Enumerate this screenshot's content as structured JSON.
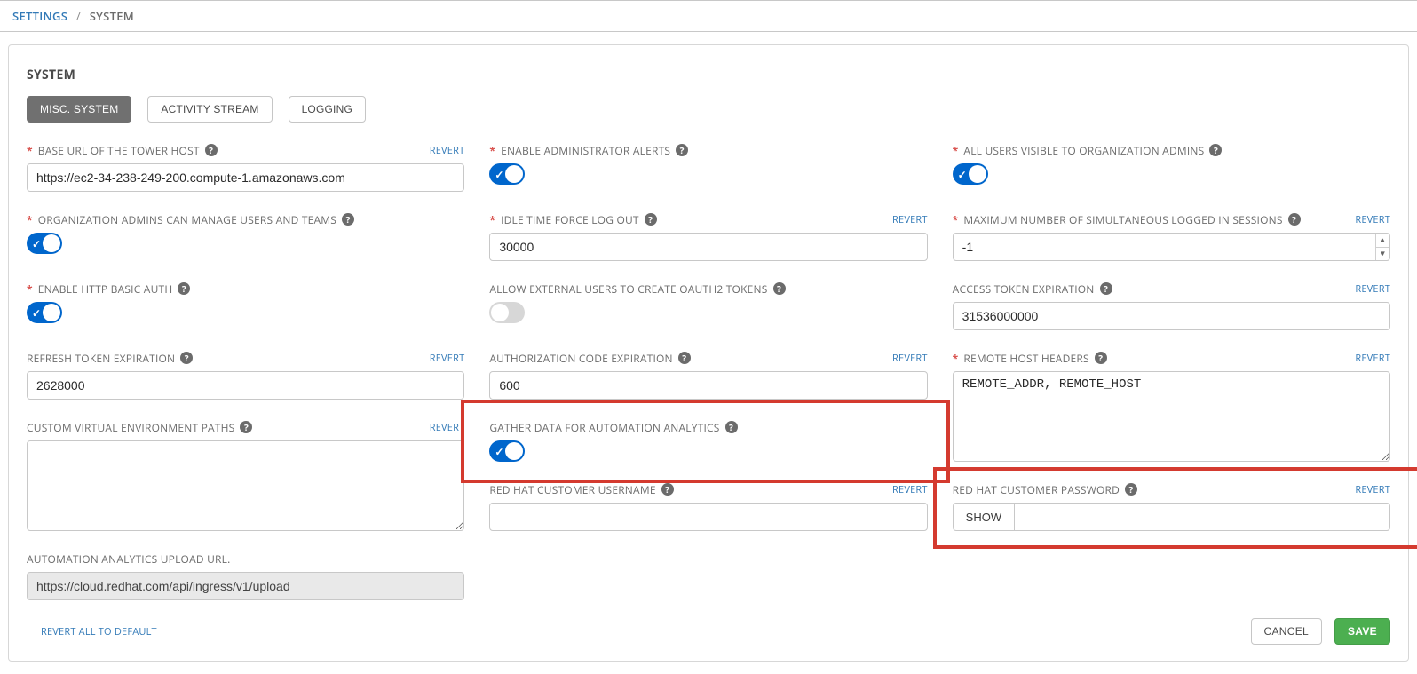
{
  "breadcrumb": {
    "root": "SETTINGS",
    "sep": "/",
    "current": "SYSTEM"
  },
  "panel": {
    "title": "SYSTEM"
  },
  "tabs": {
    "misc": "MISC. SYSTEM",
    "activity": "ACTIVITY STREAM",
    "logging": "LOGGING"
  },
  "labels": {
    "revert": "REVERT",
    "revert_all": "REVERT ALL TO DEFAULT",
    "cancel": "CANCEL",
    "save": "SAVE",
    "show": "SHOW"
  },
  "fields": {
    "base_url": {
      "label": "BASE URL OF THE TOWER HOST",
      "value": "https://ec2-34-238-249-200.compute-1.amazonaws.com",
      "required": true,
      "revert": true
    },
    "admin_alerts": {
      "label": "ENABLE ADMINISTRATOR ALERTS",
      "required": true,
      "on": true
    },
    "all_users_visible": {
      "label": "ALL USERS VISIBLE TO ORGANIZATION ADMINS",
      "required": true,
      "on": true
    },
    "org_admins_manage": {
      "label": "ORGANIZATION ADMINS CAN MANAGE USERS AND TEAMS",
      "required": true,
      "on": true
    },
    "idle_logout": {
      "label": "IDLE TIME FORCE LOG OUT",
      "required": true,
      "value": "30000",
      "revert": true
    },
    "max_sessions": {
      "label": "MAXIMUM NUMBER OF SIMULTANEOUS LOGGED IN SESSIONS",
      "required": true,
      "value": "-1",
      "revert": true
    },
    "http_basic": {
      "label": "ENABLE HTTP BASIC AUTH",
      "required": true,
      "on": true
    },
    "oauth_external": {
      "label": "ALLOW EXTERNAL USERS TO CREATE OAUTH2 TOKENS",
      "on": false
    },
    "access_token_exp": {
      "label": "ACCESS TOKEN EXPIRATION",
      "value": "31536000000",
      "revert": true
    },
    "refresh_token_exp": {
      "label": "REFRESH TOKEN EXPIRATION",
      "value": "2628000",
      "revert": true
    },
    "auth_code_exp": {
      "label": "AUTHORIZATION CODE EXPIRATION",
      "value": "600",
      "revert": true
    },
    "remote_host_headers": {
      "label": "REMOTE HOST HEADERS",
      "required": true,
      "value": "REMOTE_ADDR, REMOTE_HOST",
      "revert": true
    },
    "custom_venv": {
      "label": "CUSTOM VIRTUAL ENVIRONMENT PATHS",
      "value": "",
      "revert": true
    },
    "gather_analytics": {
      "label": "GATHER DATA FOR AUTOMATION ANALYTICS",
      "on": true
    },
    "rh_username": {
      "label": "RED HAT CUSTOMER USERNAME",
      "value": "",
      "revert": true
    },
    "rh_password": {
      "label": "RED HAT CUSTOMER PASSWORD",
      "value": "",
      "revert": true
    },
    "analytics_url": {
      "label": "AUTOMATION ANALYTICS UPLOAD URL.",
      "value": "https://cloud.redhat.com/api/ingress/v1/upload"
    }
  }
}
